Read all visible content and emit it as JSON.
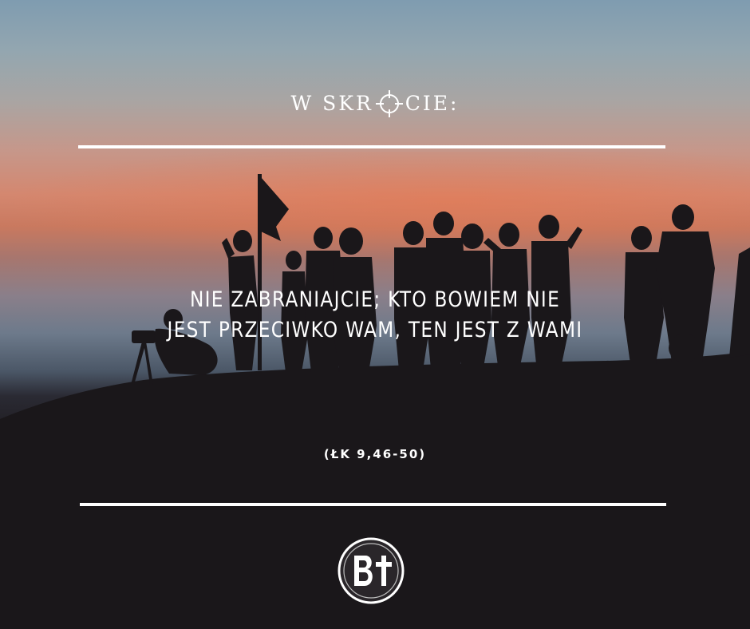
{
  "header": {
    "prefix": "W SKR",
    "suffix": "CIE:",
    "icon": "crosshair-icon"
  },
  "quote": {
    "line1": "NIE ZABRANIAJCIE; KTO BOWIEM NIE",
    "line2": "JEST PRZECIWKO WAM, TEN JEST Z WAMI"
  },
  "reference": "(ŁK 9,46-50)",
  "logo": {
    "text": "BT",
    "icon": "bt-logo-icon"
  },
  "colors": {
    "text": "#ffffff",
    "silhouette": "#1a171a",
    "sky_top": "#7f9cb0",
    "sunset_glow": "#d4876f"
  }
}
